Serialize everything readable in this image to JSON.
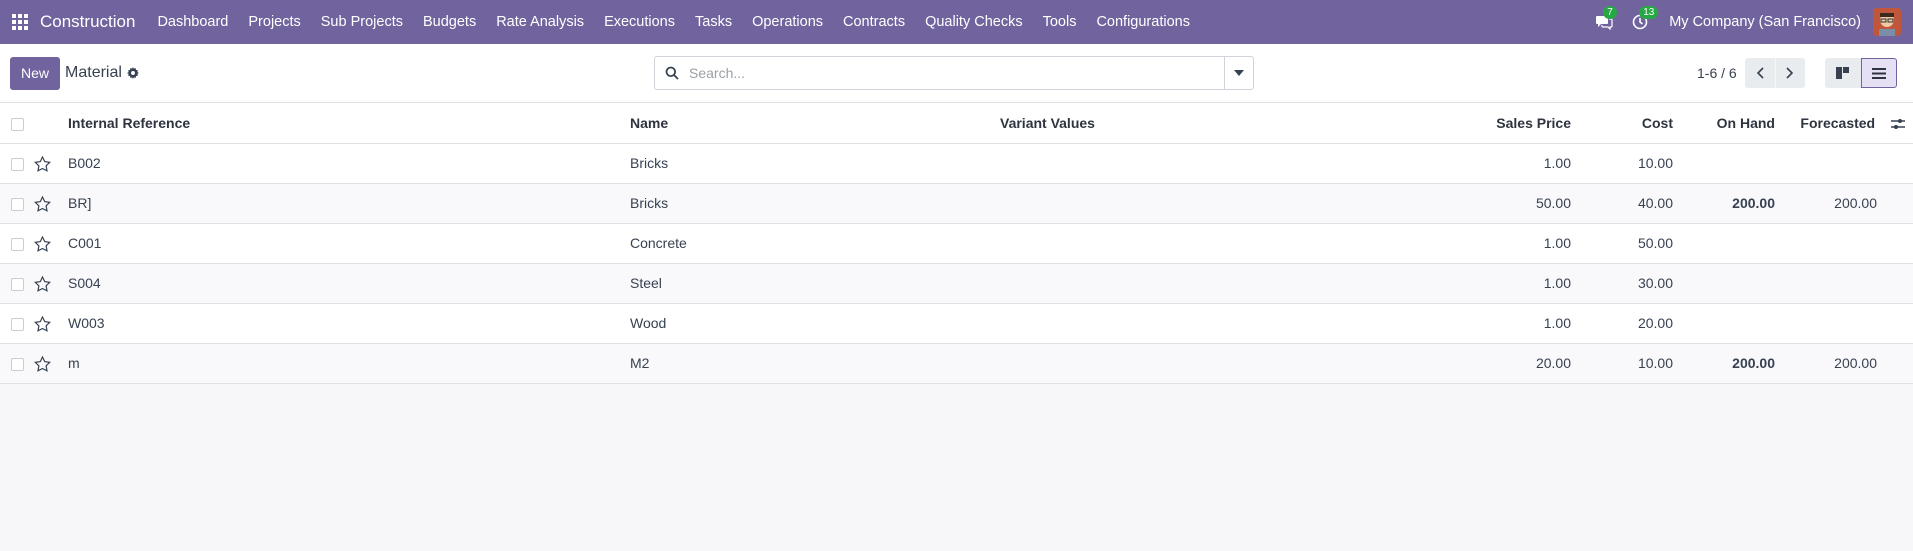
{
  "navbar": {
    "brand": "Construction",
    "menu": [
      "Dashboard",
      "Projects",
      "Sub Projects",
      "Budgets",
      "Rate Analysis",
      "Executions",
      "Tasks",
      "Operations",
      "Contracts",
      "Quality Checks",
      "Tools",
      "Configurations"
    ],
    "messages_count": "7",
    "activities_count": "13",
    "company": "My Company (San Francisco)",
    "accent": "#71639e"
  },
  "control": {
    "new_label": "New",
    "breadcrumb": "Material",
    "search_placeholder": "Search...",
    "pager": "1-6 / 6"
  },
  "table": {
    "columns": {
      "internal_reference": "Internal Reference",
      "name": "Name",
      "variant_values": "Variant Values",
      "sales_price": "Sales Price",
      "cost": "Cost",
      "on_hand": "On Hand",
      "forecasted": "Forecasted"
    },
    "rows": [
      {
        "ref": "B002",
        "name": "Bricks",
        "variant": "",
        "price": "1.00",
        "cost": "10.00",
        "on_hand": "",
        "forecasted": ""
      },
      {
        "ref": "BR]",
        "name": "Bricks",
        "variant": "",
        "price": "50.00",
        "cost": "40.00",
        "on_hand": "200.00",
        "forecasted": "200.00"
      },
      {
        "ref": "C001",
        "name": "Concrete",
        "variant": "",
        "price": "1.00",
        "cost": "50.00",
        "on_hand": "",
        "forecasted": ""
      },
      {
        "ref": "S004",
        "name": "Steel",
        "variant": "",
        "price": "1.00",
        "cost": "30.00",
        "on_hand": "",
        "forecasted": ""
      },
      {
        "ref": "W003",
        "name": "Wood",
        "variant": "",
        "price": "1.00",
        "cost": "20.00",
        "on_hand": "",
        "forecasted": ""
      },
      {
        "ref": "m",
        "name": "M2",
        "variant": "",
        "price": "20.00",
        "cost": "10.00",
        "on_hand": "200.00",
        "forecasted": "200.00"
      }
    ]
  }
}
